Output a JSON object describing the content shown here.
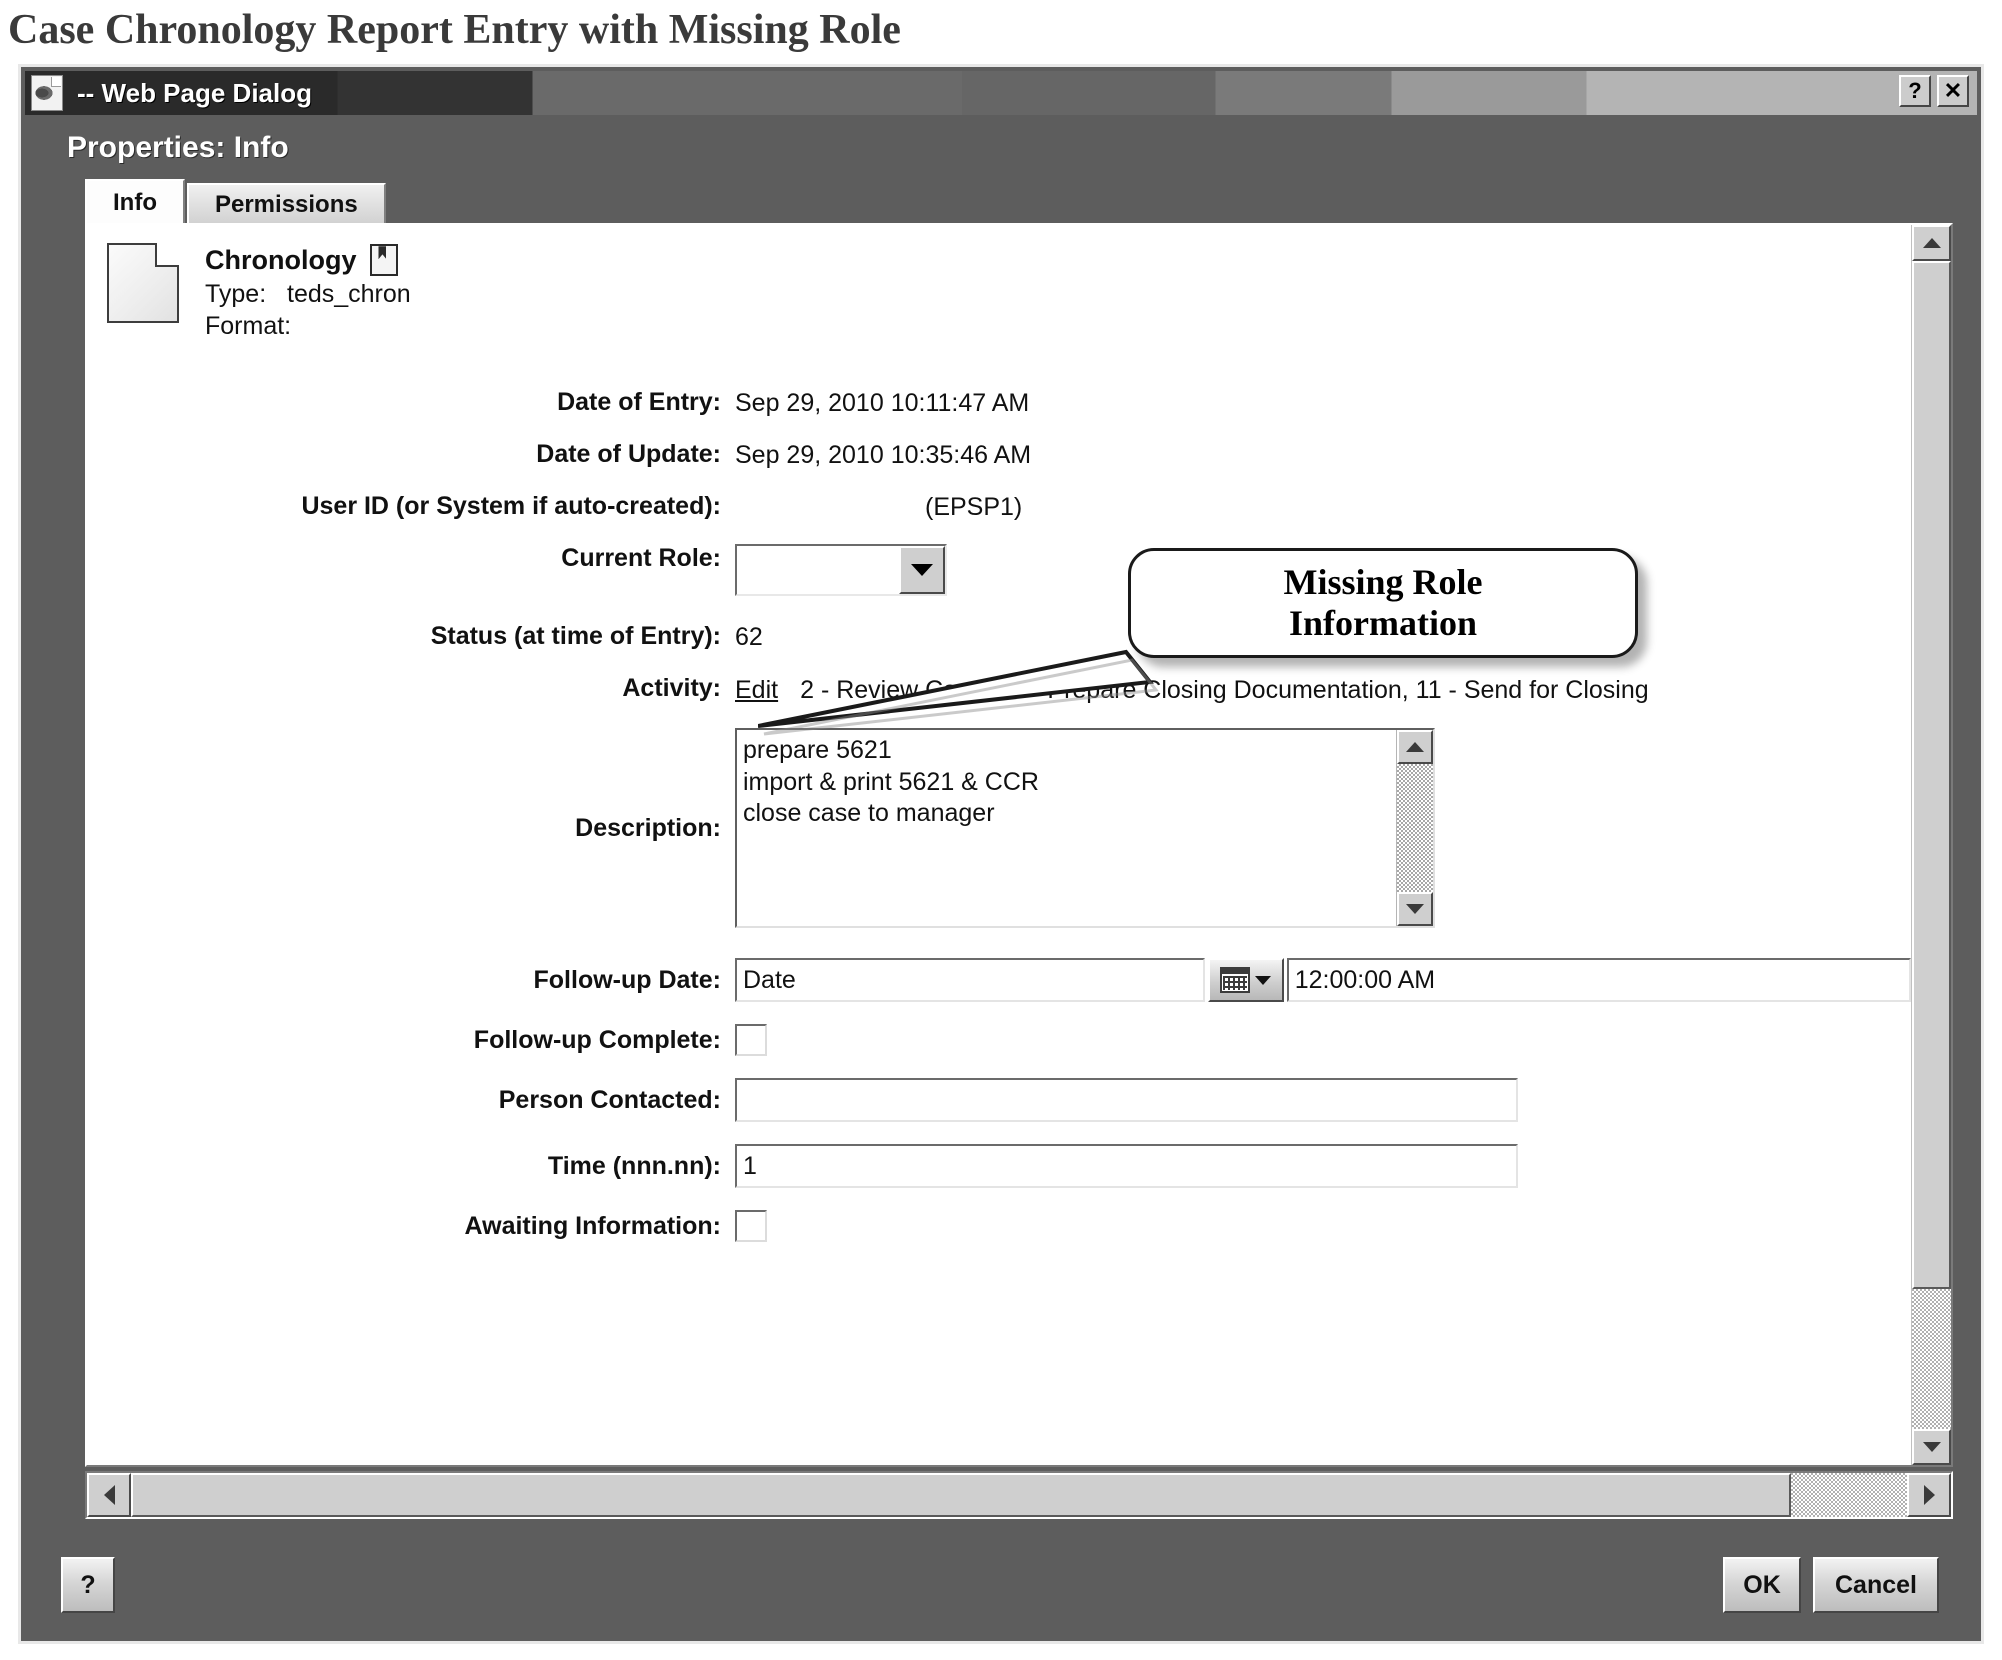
{
  "page": {
    "caption": "Case Chronology Report Entry with Missing Role"
  },
  "window": {
    "title": "-- Web Page Dialog",
    "help_button": "?",
    "close_button": "✕",
    "heading": "Properties: Info"
  },
  "tabs": [
    {
      "label": "Info",
      "active": true
    },
    {
      "label": "Permissions",
      "active": false
    }
  ],
  "document": {
    "name": "Chronology",
    "type_label": "Type:",
    "type_value": "teds_chron",
    "format_label": "Format:",
    "format_value": ""
  },
  "fields": {
    "date_of_entry": {
      "label": "Date of Entry:",
      "value": "Sep 29, 2010 10:11:47 AM"
    },
    "date_of_update": {
      "label": "Date of Update:",
      "value": "Sep 29, 2010 10:35:46 AM"
    },
    "user_id": {
      "label": "User ID (or System if auto-created):",
      "value": "(EPSP1)"
    },
    "current_role": {
      "label": "Current Role:",
      "value": ""
    },
    "status": {
      "label": "Status (at time of Entry):",
      "value": "62"
    },
    "activity": {
      "label": "Activity:",
      "edit_link": "Edit",
      "value": "2 - Review Case, 10 - Prepare Closing Documentation, 11 - Send for Closing"
    },
    "description": {
      "label": "Description:",
      "value": "prepare 5621\nimport & print 5621 & CCR\nclose case to manager"
    },
    "followup_date": {
      "label": "Follow-up Date:",
      "value": "Date",
      "time_value": "12:00:00 AM"
    },
    "followup_complete": {
      "label": "Follow-up Complete:",
      "checked": false
    },
    "person_contacted": {
      "label": "Person Contacted:",
      "value": ""
    },
    "time": {
      "label": "Time (nnn.nn):",
      "value": "1"
    },
    "awaiting_information": {
      "label": "Awaiting Information:",
      "checked": false
    }
  },
  "callout": {
    "text": "Missing Role\nInformation"
  },
  "footer": {
    "help_label": "?",
    "ok_label": "OK",
    "cancel_label": "Cancel"
  },
  "colors": {
    "dialog_body": "#5d5d5d",
    "titlebar_dark": "#2a2a2a",
    "control_face": "#cfcfcf",
    "content_bg": "#ffffff"
  }
}
